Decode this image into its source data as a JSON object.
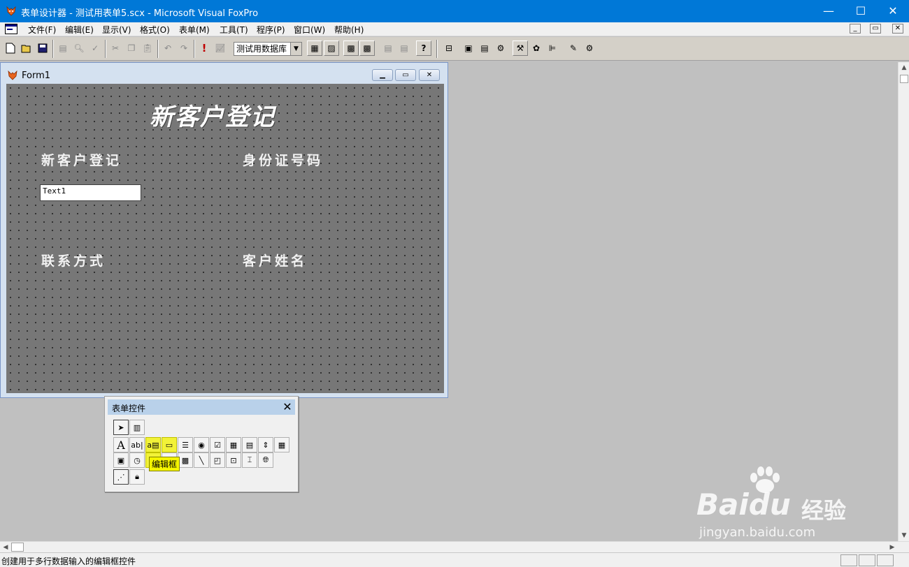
{
  "window": {
    "title": "表单设计器 - 测试用表单5.scx - Microsoft Visual FoxPro",
    "minimize": "—",
    "maximize": "☐",
    "close": "✕",
    "title_bar_color": "#0078d7"
  },
  "menubar": {
    "items": [
      "文件(F)",
      "编辑(E)",
      "显示(V)",
      "格式(O)",
      "表单(M)",
      "工具(T)",
      "程序(P)",
      "窗口(W)",
      "帮助(H)"
    ],
    "mdi_minimize": "_",
    "mdi_restore": "▭",
    "mdi_close": "✕"
  },
  "toolbar": {
    "database_combo": "测试用数据库",
    "combo_arrow": "▼",
    "run_glyph": "!",
    "help_glyph": "?"
  },
  "form_window": {
    "title": "Form1",
    "canvas_color": "#777777",
    "big_title": "新客户登记",
    "labels": {
      "label1": "新客户登记",
      "label2": "身份证号码",
      "label3": "联系方式",
      "label4": "客户姓名"
    },
    "textbox_value": "Text1"
  },
  "toolbox": {
    "title": "表单控件",
    "close": "✕",
    "tooltip": "编辑框",
    "highlight_color": "#f2f238"
  },
  "statusbar": {
    "text": "创建用于多行数据输入的编辑框控件"
  },
  "watermark": {
    "brand": "Baidu",
    "brand_cn": "经验",
    "url": "jingyan.baidu.com"
  }
}
